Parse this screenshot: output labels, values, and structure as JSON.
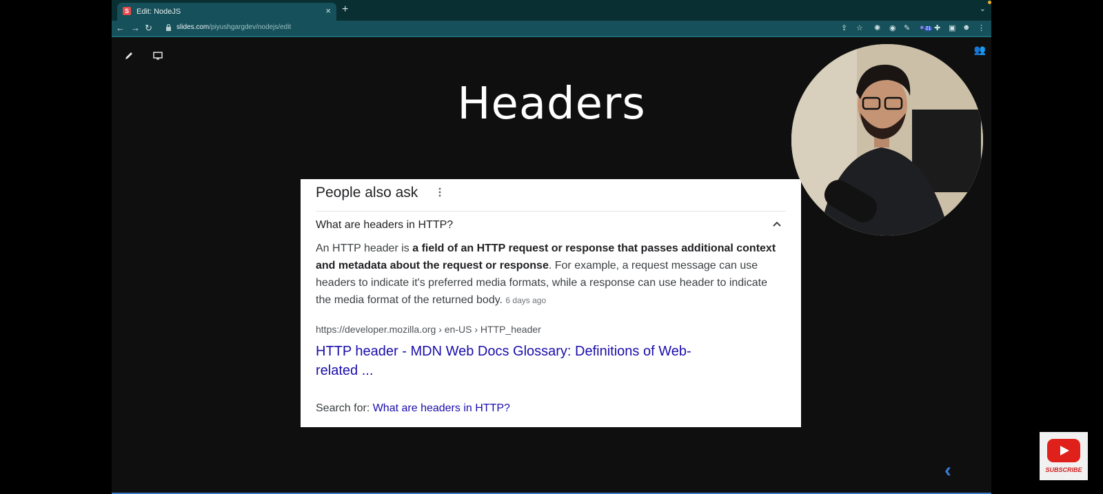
{
  "browser": {
    "tab": {
      "favicon_letter": "S",
      "title": "Edit: NodeJS",
      "close": "×"
    },
    "new_tab": "+",
    "tab_menu": "⌄",
    "url": {
      "host": "slides.com",
      "path": "/piyushgargdev/nodejs/edit"
    },
    "nav": {
      "back": "←",
      "forward": "→",
      "reload": "↻"
    },
    "extension_badge": "21"
  },
  "slide": {
    "title": "Headers",
    "card": {
      "heading": "People also ask",
      "question": "What are headers in HTTP?",
      "answer": {
        "before": "An HTTP header is ",
        "bold": "a field of an HTTP request or response that passes additional context and metadata about the request or response",
        "after": ". For example, a request message can use headers to indicate it's preferred media formats, while a response can use header to indicate the media format of the returned body.",
        "age": "6 days ago"
      },
      "cite": "https://developer.mozilla.org › en-US › HTTP_header",
      "link": "HTTP header - MDN Web Docs Glossary: Definitions of Web-related ...",
      "search_for_label": "Search for: ",
      "search_for_query": "What are headers in HTTP?"
    },
    "back_arrow": "‹"
  },
  "subscribe": {
    "label": "SUBSCRIBE"
  },
  "colors": {
    "accent": "#16505a",
    "link": "#1a0dab",
    "youtube_red": "#e0201b"
  }
}
